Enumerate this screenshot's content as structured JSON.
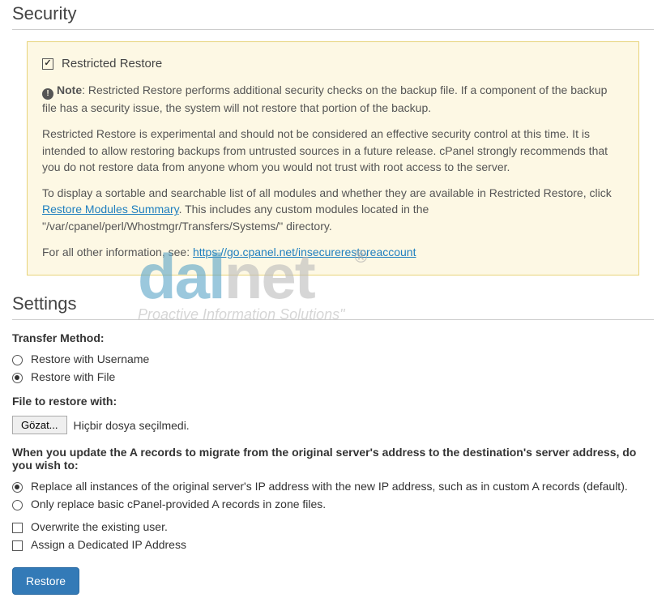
{
  "security": {
    "heading": "Security",
    "restricted_label": "Restricted Restore",
    "note_prefix": "Note",
    "note_text": ": Restricted Restore performs additional security checks on the backup file. If a component of the backup file has a security issue, the system will not restore that portion of the backup.",
    "para2": "Restricted Restore is experimental and should not be considered an effective security control at this time. It is intended to allow restoring backups from untrusted sources in a future release. cPanel strongly recommends that you do not restore data from anyone whom you would not trust with root access to the server.",
    "para3_pre": "To display a sortable and searchable list of all modules and whether they are available in Restricted Restore, click ",
    "para3_link": "Restore Modules Summary",
    "para3_post": ". This includes any custom modules located in the \"/var/cpanel/perl/Whostmgr/Transfers/Systems/\" directory.",
    "para4_pre": "For all other information, see: ",
    "para4_link": "https://go.cpanel.net/insecurerestoreaccount"
  },
  "settings": {
    "heading": "Settings",
    "transfer_method_label": "Transfer Method:",
    "radio_username": "Restore with Username",
    "radio_file": "Restore with File",
    "file_label": "File to restore with:",
    "file_button": "Gözat...",
    "file_status": "Hiçbir dosya seçilmedi.",
    "a_records_label": "When you update the A records to migrate from the original server's address to the destination's server address, do you wish to:",
    "radio_replace_all": "Replace all instances of the original server's IP address with the new IP address, such as in custom A records (default).",
    "radio_replace_basic": "Only replace basic cPanel-provided A records in zone files.",
    "chk_overwrite": "Overwrite the existing user.",
    "chk_dedicated_ip": "Assign a Dedicated IP Address",
    "restore_button": "Restore"
  },
  "watermark": {
    "dal": "dal",
    "net": "net",
    "reg": "®",
    "tagline": "Proactive Information Solutions\""
  }
}
